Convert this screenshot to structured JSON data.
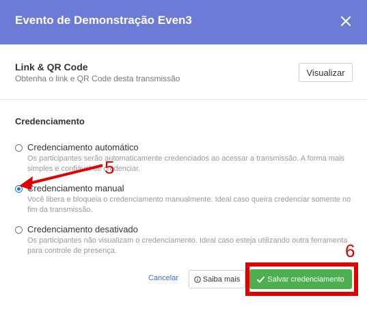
{
  "modal": {
    "title": "Evento de Demonstração Even3",
    "close_icon": "close-icon"
  },
  "link_section": {
    "title": "Link & QR Code",
    "description": "Obtenha o link e QR Code desta transmissão",
    "button": "Visualizar"
  },
  "credentialing": {
    "title": "Credenciamento",
    "options": [
      {
        "label": "Credenciamento automático",
        "description": "Os participantes serão automaticamente credenciados ao acessar a transmissão. A forma mais simples e confiável de credenciar.",
        "selected": false
      },
      {
        "label": "Credenciamento manual",
        "description": "Você libera e bloqueia o credenciamento manualmente. Ideal caso queira credenciar somente no fim da transmissão.",
        "selected": true
      },
      {
        "label": "Credenciamento desativado",
        "description": "Os participantes não visualizam o credenciamento. Ideal caso esteja utilizando outra ferramenta para controle de presença.",
        "selected": false
      }
    ]
  },
  "footer": {
    "cancel": "Cancelar",
    "learn_more": "Saiba mais",
    "save": "Salvar credenciamento"
  },
  "annotations": {
    "step5": "5",
    "step6": "6",
    "color": "#e00000"
  },
  "colors": {
    "header": "#6b7bd6",
    "save_button": "#4caf50",
    "radio_selected": "#1a73e8"
  }
}
